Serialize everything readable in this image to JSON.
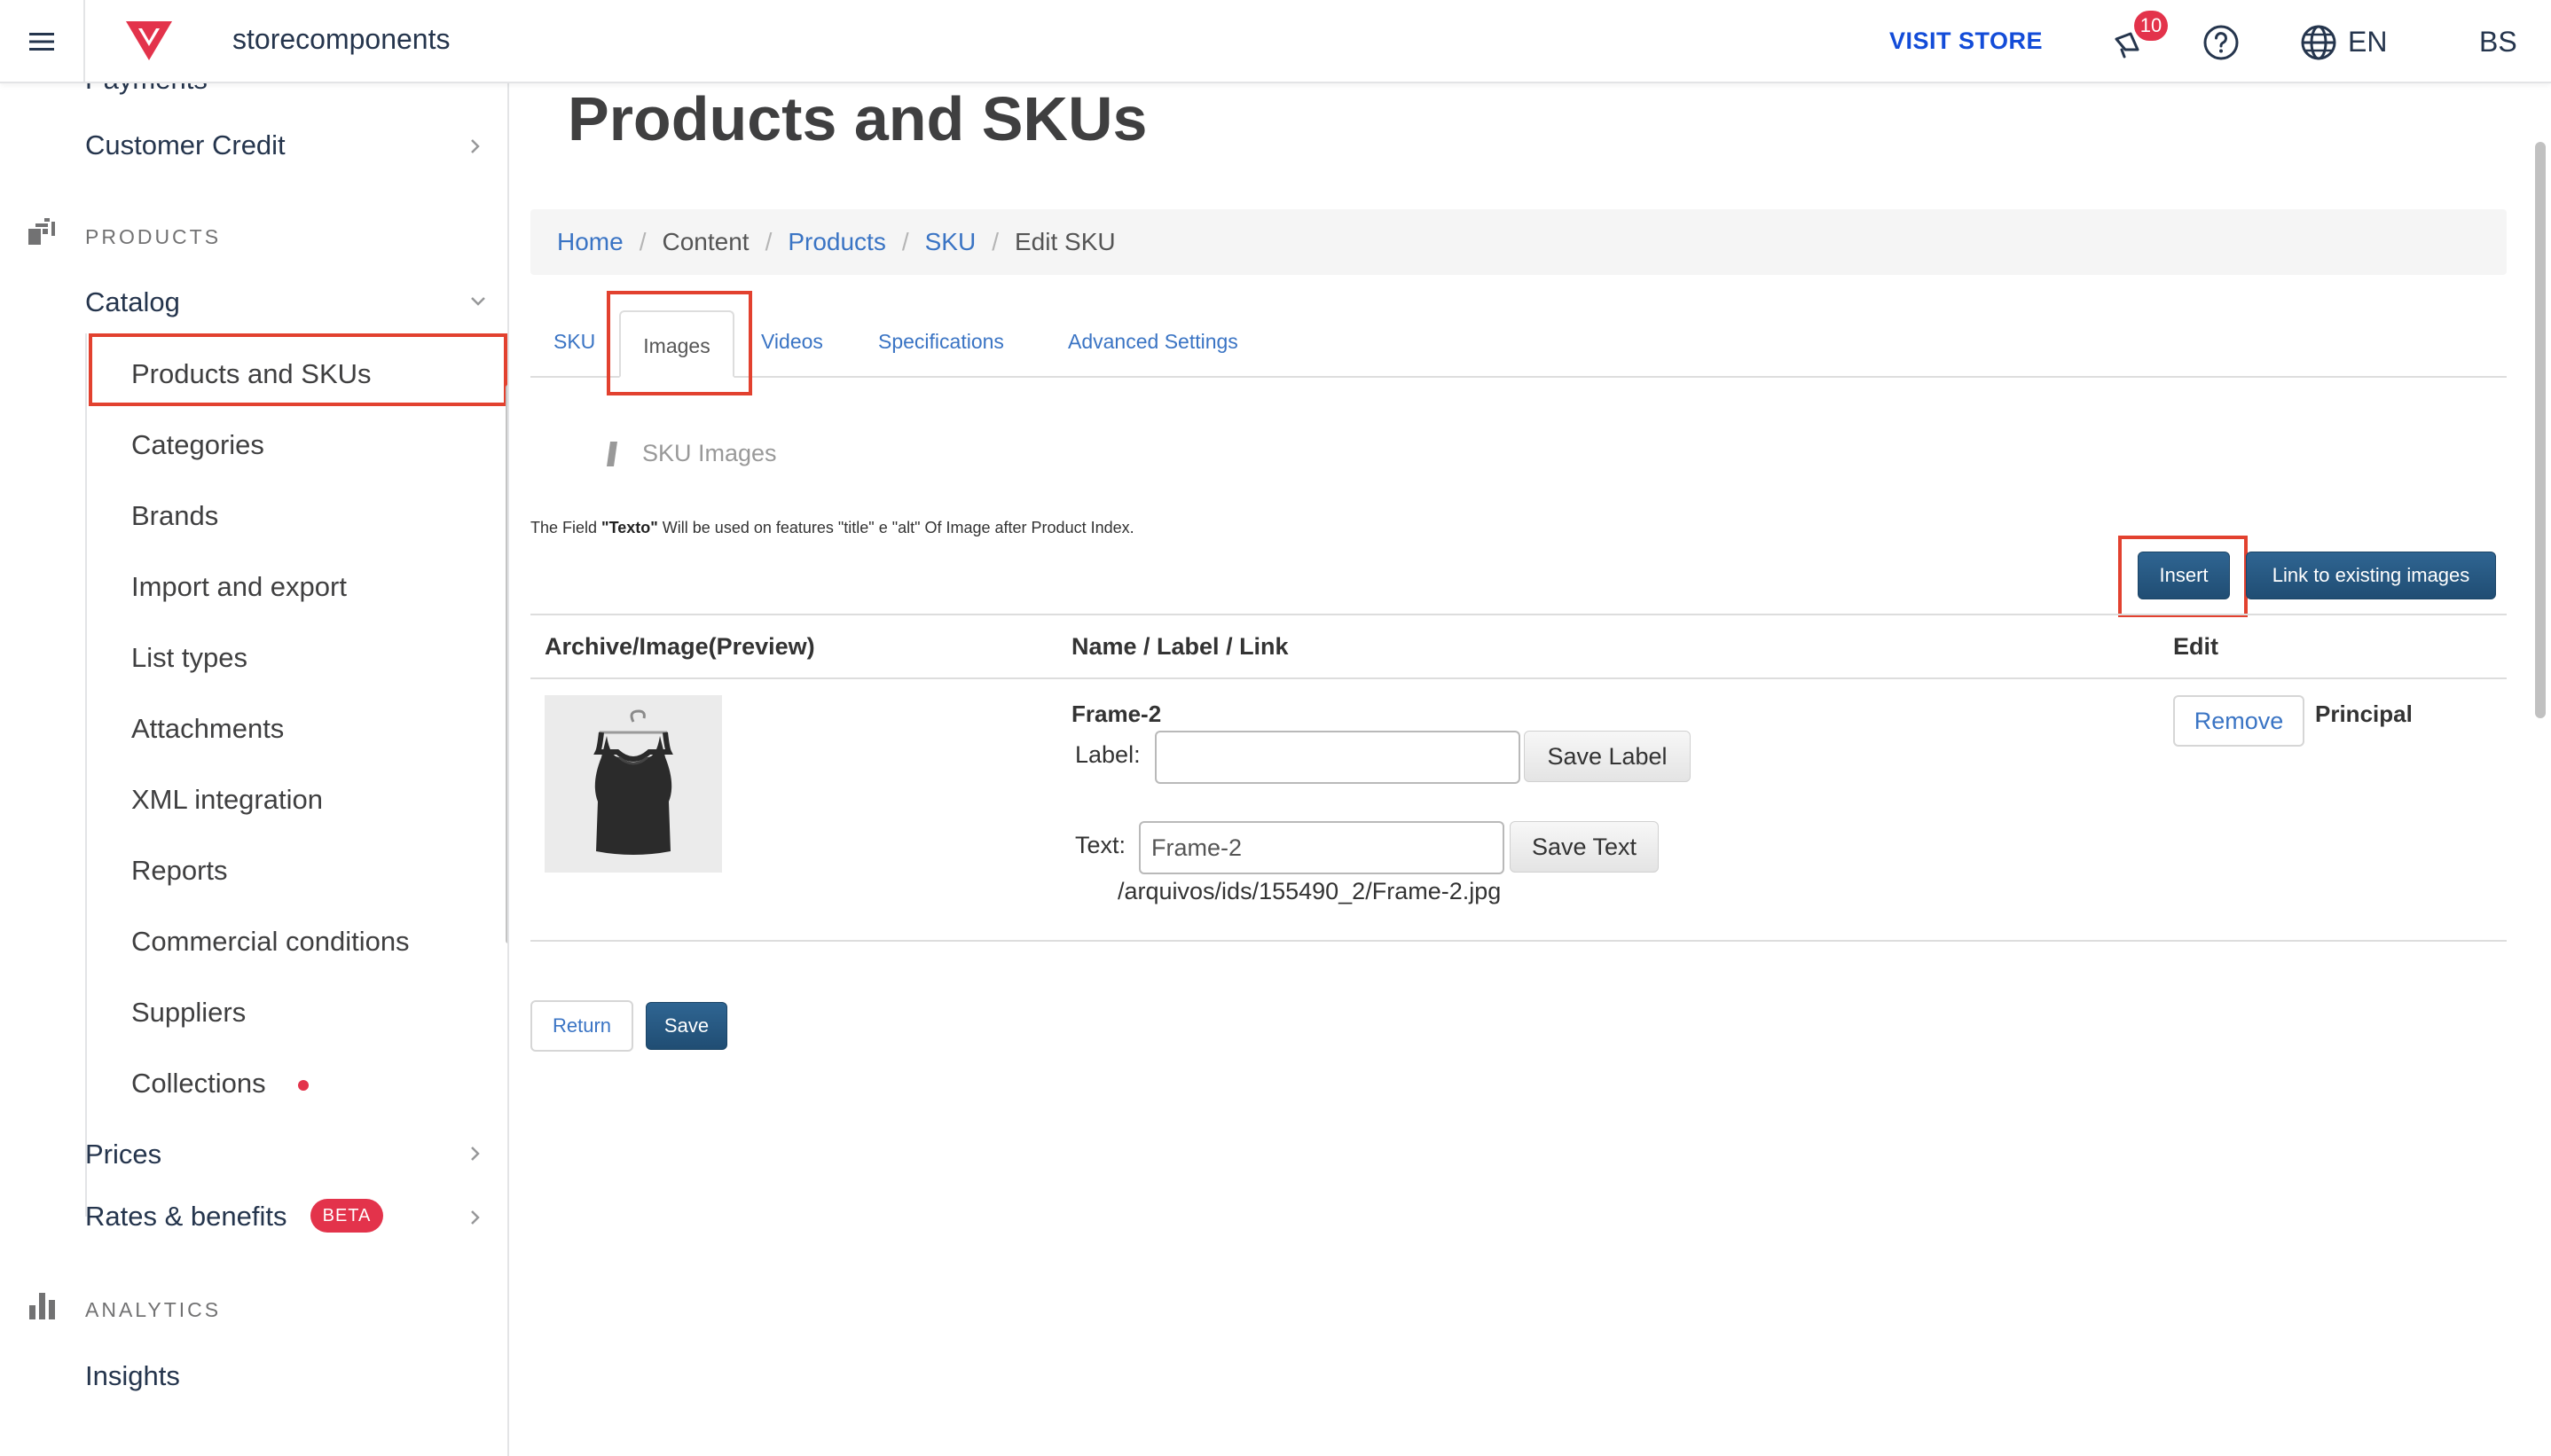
{
  "topbar": {
    "account_name": "storecomponents",
    "visit_store": "VISIT STORE",
    "notifications_count": "10",
    "language": "EN",
    "user_initials": "BS"
  },
  "sidebar": {
    "partial_item": "Payments",
    "customer_credit": "Customer Credit",
    "products_section": "PRODUCTS",
    "catalog": "Catalog",
    "catalog_items": [
      "Products and SKUs",
      "Categories",
      "Brands",
      "Import and export",
      "List types",
      "Attachments",
      "XML integration",
      "Reports",
      "Commercial conditions",
      "Suppliers",
      "Collections"
    ],
    "prices": "Prices",
    "rates_benefits": "Rates & benefits",
    "beta_badge": "BETA",
    "analytics_section": "ANALYTICS",
    "insights": "Insights"
  },
  "main": {
    "page_title": "Products and SKUs",
    "breadcrumb": [
      "Home",
      "Content",
      "Products",
      "SKU",
      "Edit SKU"
    ],
    "tabs": [
      "SKU",
      "Images",
      "Videos",
      "Specifications",
      "Advanced Settings"
    ],
    "active_tab": "Images",
    "section_title": "SKU Images",
    "note_prefix": "The Field ",
    "note_bold": "\"Texto\"",
    "note_suffix": " Will be used on features \"title\" e \"alt\" Of Image after Product Index.",
    "insert_button": "Insert",
    "link_existing_button": "Link to existing images",
    "table": {
      "headers": [
        "Archive/Image(Preview)",
        "Name / Label / Link",
        "Edit"
      ],
      "row": {
        "name": "Frame-2",
        "label_caption": "Label:",
        "label_value": "",
        "save_label_button": "Save Label",
        "text_caption": "Text:",
        "text_value": "Frame-2",
        "save_text_button": "Save Text",
        "path": "/arquivos/ids/155490_2/Frame-2.jpg",
        "remove_button": "Remove",
        "principal": "Principal"
      }
    },
    "return_button": "Return",
    "save_button": "Save"
  },
  "colors": {
    "accent_red": "#e3334b",
    "link_blue": "#3a74c4",
    "visit_store_blue": "#134cd8",
    "primary_button": "#2a5b85",
    "highlight_box": "#e2412f"
  }
}
